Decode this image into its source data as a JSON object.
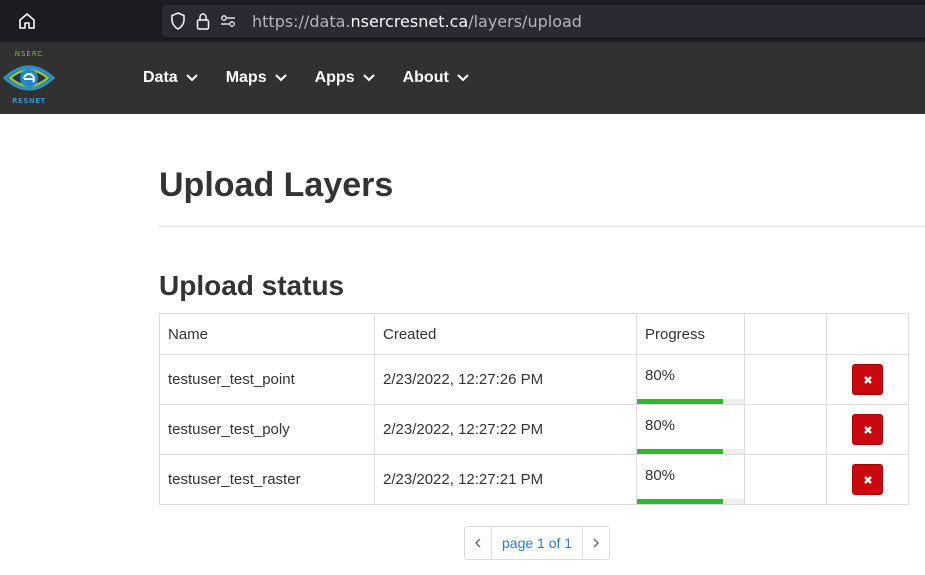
{
  "browser": {
    "url_prefix": "https://data.",
    "url_domain": "nsercresnet.ca",
    "url_path": "/layers/upload"
  },
  "nav": {
    "logo_top": "NSERC",
    "logo_bottom": "RESNET",
    "items": [
      {
        "label": "Data"
      },
      {
        "label": "Maps"
      },
      {
        "label": "Apps"
      },
      {
        "label": "About"
      }
    ]
  },
  "page": {
    "title": "Upload Layers",
    "section_title": "Upload status"
  },
  "table": {
    "headers": {
      "name": "Name",
      "created": "Created",
      "progress": "Progress"
    },
    "rows": [
      {
        "name": "testuser_test_point",
        "created": "2/23/2022, 12:27:26 PM",
        "progress_label": "80%",
        "progress": 0.8
      },
      {
        "name": "testuser_test_poly",
        "created": "2/23/2022, 12:27:22 PM",
        "progress_label": "80%",
        "progress": 0.8
      },
      {
        "name": "testuser_test_raster",
        "created": "2/23/2022, 12:27:21 PM",
        "progress_label": "80%",
        "progress": 0.8
      }
    ]
  },
  "pagination": {
    "label": "page 1 of 1"
  },
  "colors": {
    "navbar": "#313131",
    "progress": "#2eb82e",
    "delete": "#c9090f",
    "link": "#337ab7"
  }
}
